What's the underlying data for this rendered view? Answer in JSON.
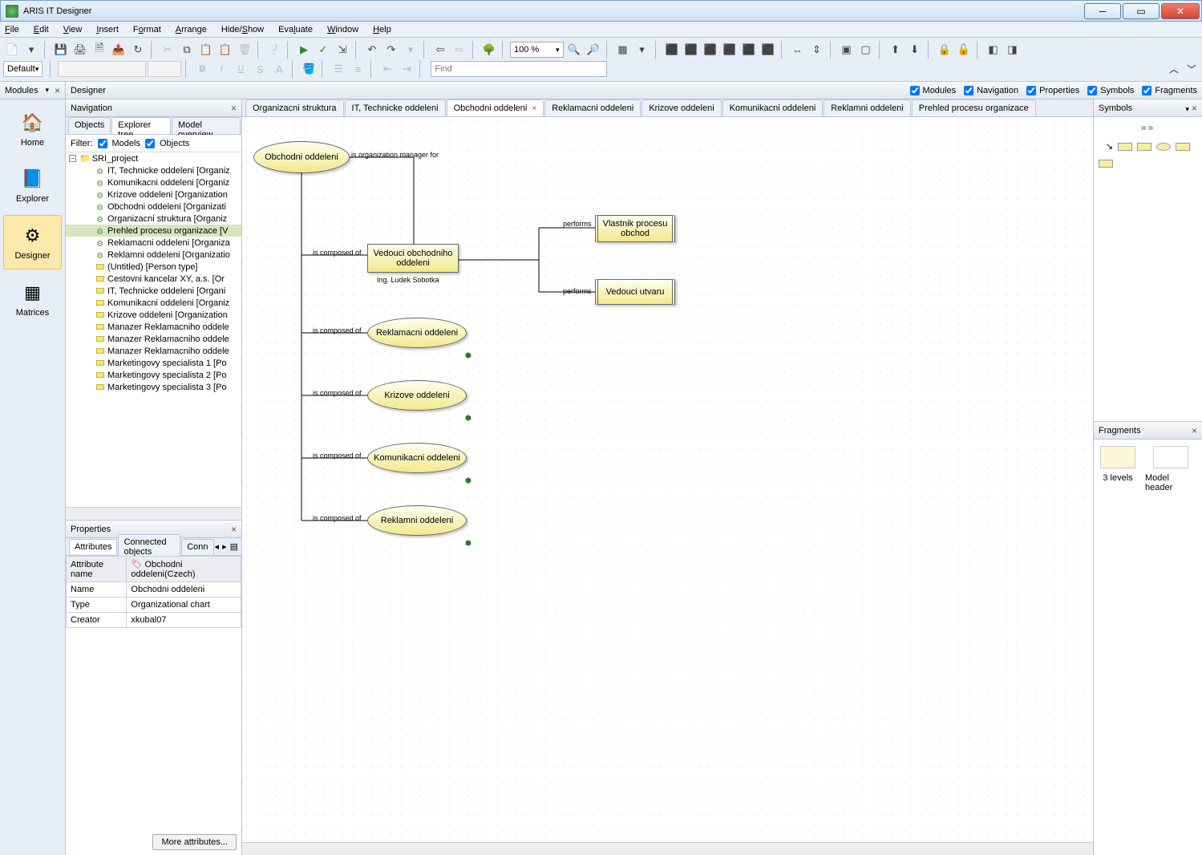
{
  "window": {
    "title": "ARIS IT Designer"
  },
  "menu": {
    "items": [
      "File",
      "Edit",
      "View",
      "Insert",
      "Format",
      "Arrange",
      "Hide/Show",
      "Evaluate",
      "Window",
      "Help"
    ]
  },
  "toolbar": {
    "zoom_value": "100 %",
    "style_select": "Default",
    "find_placeholder": "Find"
  },
  "designer_bar": {
    "title": "Designer",
    "checks": [
      {
        "label": "Modules",
        "checked": true
      },
      {
        "label": "Navigation",
        "checked": true
      },
      {
        "label": "Properties",
        "checked": true
      },
      {
        "label": "Symbols",
        "checked": true
      },
      {
        "label": "Fragments",
        "checked": true
      }
    ]
  },
  "modules_panel": {
    "title": "Modules",
    "items": [
      {
        "label": "Home",
        "icon": "🏠"
      },
      {
        "label": "Explorer",
        "icon": "📘"
      },
      {
        "label": "Designer",
        "icon": "⚙",
        "active": true
      },
      {
        "label": "Matrices",
        "icon": "▦"
      }
    ]
  },
  "navigation": {
    "title": "Navigation",
    "sub_tabs": [
      "Objects",
      "Explorer tree",
      "Model overview"
    ],
    "sub_active": 1,
    "filter_label": "Filter:",
    "filter_models": "Models",
    "filter_objects": "Objects",
    "root": "SRI_project",
    "items": [
      {
        "kind": "g",
        "label": "IT, Technicke oddeleni [Organiz"
      },
      {
        "kind": "g",
        "label": "Komunikacni oddeleni [Organiz"
      },
      {
        "kind": "g",
        "label": "Krizove oddeleni [Organization"
      },
      {
        "kind": "g",
        "label": "Obchodni oddeleni [Organizati"
      },
      {
        "kind": "g",
        "label": "Organizacni struktura [Organiz"
      },
      {
        "kind": "g",
        "label": "Prehled procesu organizace [V",
        "sel": true
      },
      {
        "kind": "g",
        "label": "Reklamacni oddeleni [Organiza"
      },
      {
        "kind": "g",
        "label": "Reklamni oddeleni [Organizatio"
      },
      {
        "kind": "y",
        "label": "(Untitled) [Person type]"
      },
      {
        "kind": "y",
        "label": "Cestovni kancelar XY, a.s. [Or"
      },
      {
        "kind": "y",
        "label": "IT, Technicke oddeleni [Organi"
      },
      {
        "kind": "y",
        "label": "Komunikacni oddeleni [Organiz"
      },
      {
        "kind": "y",
        "label": "Krizove oddeleni [Organization"
      },
      {
        "kind": "y",
        "label": "Manazer Reklamacniho oddele"
      },
      {
        "kind": "y",
        "label": "Manazer Reklamacniho oddele"
      },
      {
        "kind": "y",
        "label": "Manazer Reklamacniho oddele"
      },
      {
        "kind": "y",
        "label": "Marketingovy specialista 1 [Po"
      },
      {
        "kind": "y",
        "label": "Marketingovy specialista 2 [Po"
      },
      {
        "kind": "y",
        "label": "Marketingovy specialista 3 [Po"
      }
    ]
  },
  "properties": {
    "title": "Properties",
    "tabs": [
      "Attributes",
      "Connected objects",
      "Conn"
    ],
    "header_attr": "Attribute name",
    "header_val": "Obchodni oddeleni(Czech)",
    "rows": [
      {
        "attr": "Name",
        "val": "Obchodni oddeleni"
      },
      {
        "attr": "Type",
        "val": "Organizational chart"
      },
      {
        "attr": "Creator",
        "val": "xkubal07"
      }
    ],
    "more": "More attributes..."
  },
  "doc_tabs": {
    "items": [
      "Organizacni struktura",
      "IT, Technicke oddeleni",
      "Obchodni oddeleni",
      "Reklamacni oddeleni",
      "Krizove oddeleni",
      "Komunikacni oddeleni",
      "Reklamni oddeleni",
      "Prehled procesu organizace"
    ],
    "active": 2
  },
  "diagram": {
    "labels": {
      "org_manager": "is organization manager for",
      "composed": "is composed of",
      "performs": "performs",
      "person": "Ing. Ludek Sobotka"
    },
    "nodes": {
      "root": "Obchodni oddeleni",
      "vedouci": "Vedouci obchodniho oddeleni",
      "vlastnik": "Vlastnik procesu obchod",
      "utvar": "Vedouci utvaru",
      "reklamacni": "Reklamacni oddeleni",
      "krizove": "Krizove oddeleni",
      "komunikacni": "Komunikacni oddeleni",
      "reklamni": "Reklamni oddeleni"
    }
  },
  "symbols": {
    "title": "Symbols"
  },
  "fragments": {
    "title": "Fragments",
    "items": [
      "3 levels",
      "Model header"
    ]
  }
}
